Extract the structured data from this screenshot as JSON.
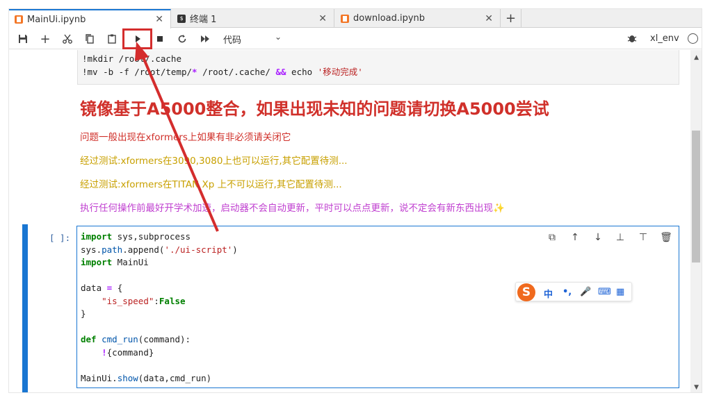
{
  "tabs": [
    {
      "label": "MainUi.ipynb",
      "icon": "notebook-icon",
      "active": true
    },
    {
      "label": "终端 1",
      "icon": "terminal-icon",
      "active": false
    },
    {
      "label": "download.ipynb",
      "icon": "notebook-icon",
      "active": false
    }
  ],
  "close_glyph": "✕",
  "add_tab_glyph": "+",
  "toolbar": {
    "cell_type": "代码",
    "kernel": "xl_env",
    "buttons": [
      "save-icon",
      "add-cell-icon",
      "cut-icon",
      "copy-icon",
      "paste-icon",
      "run-icon",
      "stop-icon",
      "restart-icon",
      "run-all-icon"
    ]
  },
  "cell1": {
    "line1": "!mkdir /root/.cache",
    "line2_parts": [
      "!mv -b -f /root/temp/",
      "*",
      " /root/.cache/ ",
      "&&",
      " echo ",
      "'移动完成'"
    ]
  },
  "markdown": {
    "title": "镜像基于A5000整合，如果出现未知的问题请切换A5000尝试",
    "line1": "问题一般出现在xformers上如果有非必须请关闭它",
    "line2": "经过测试:xformers在3090,3080上也可以运行,其它配置待测...",
    "line3": "经过测试:xformers在TITAN Xp 上不可以运行,其它配置待测...",
    "line4": "执行任何操作前最好开学术加速，启动器不会自动更新，平时可以点点更新，说不定会有新东西出现✨"
  },
  "cell2": {
    "prompt": "[ ]:",
    "code": [
      "import sys,subprocess",
      "sys.path.append('./ui-script')",
      "import MainUi",
      "",
      "data = {",
      "    \"is_speed\":False",
      "}",
      "",
      "def cmd_run(command):",
      "    !{command}",
      "",
      "MainUi.show(data,cmd_run)"
    ]
  },
  "ime": {
    "logo": "S",
    "items": [
      "中",
      "•,",
      "🎤",
      "⌨",
      "▦"
    ]
  },
  "colors": {
    "accent": "#1976d2",
    "highlight": "#d42d2d",
    "md_red": "#d0302a",
    "md_yellow": "#c8a000",
    "md_purple": "#c040d0"
  }
}
